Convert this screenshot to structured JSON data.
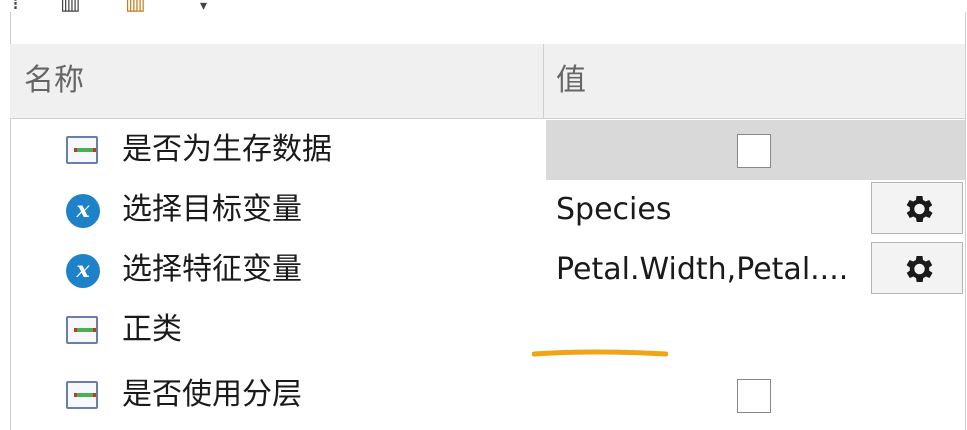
{
  "toolbar": {
    "icons": [
      "grid-icon",
      "grid-icon",
      "dropdown-arrow-icon"
    ]
  },
  "header": {
    "name_col": "名称",
    "value_col": "值"
  },
  "rows": [
    {
      "icon": "property-icon",
      "label": "是否为生存数据",
      "value": "",
      "control": "checkbox",
      "checked": false,
      "shaded": true
    },
    {
      "icon": "variable-icon",
      "label": "选择目标变量",
      "value": "Species",
      "control": "gear-button"
    },
    {
      "icon": "variable-icon",
      "label": "选择特征变量",
      "value": "Petal.Width,Petal....",
      "control": "gear-button"
    },
    {
      "icon": "property-icon",
      "label": "正类",
      "value": "",
      "control": "none"
    },
    {
      "icon": "property-icon",
      "label": "是否使用分层",
      "value": "",
      "control": "checkbox",
      "checked": false
    }
  ],
  "colors": {
    "accent_icon": "#1e82c8",
    "annotation": "#f0a418",
    "shaded_cell": "#d9d9d9"
  }
}
